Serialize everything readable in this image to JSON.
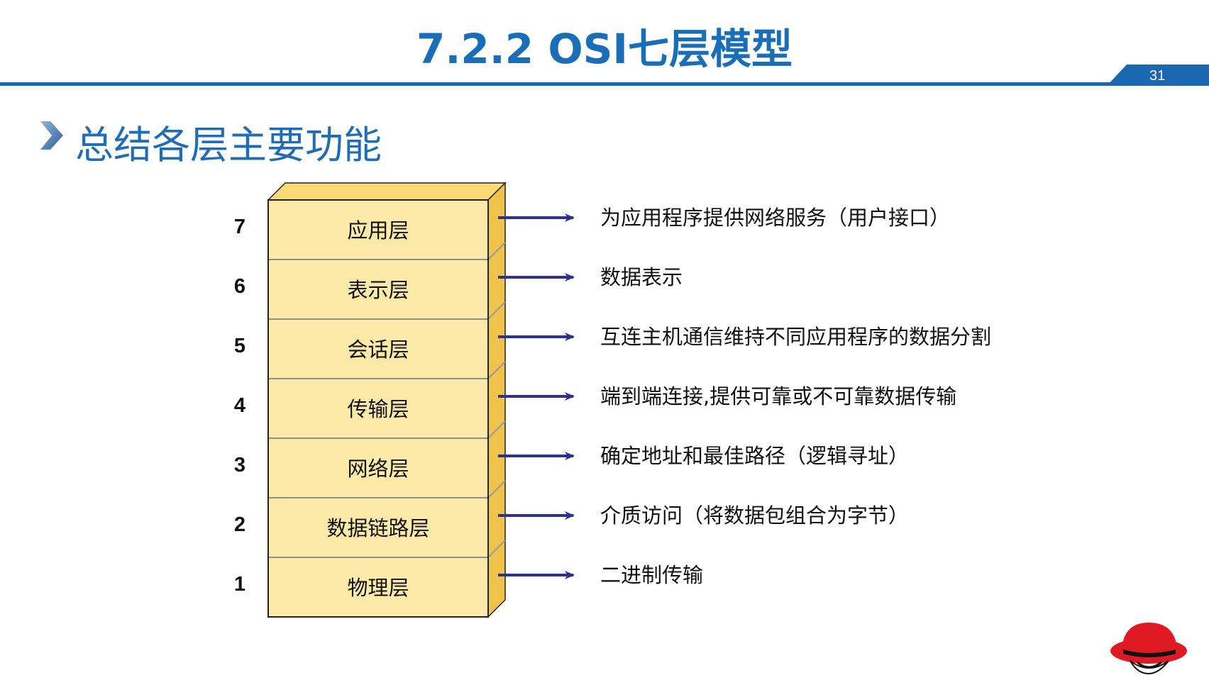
{
  "slide": {
    "title": "7.2.2 OSI七层模型",
    "page_number": "31",
    "section_heading": "总结各层主要功能"
  },
  "colors": {
    "brand_blue": "#1b67b1",
    "layer_front": "#fdeaa9",
    "layer_top": "#fbd976",
    "layer_side": "#f0c44a",
    "arrow": "#2e3192"
  },
  "icons": {
    "bullet": "chevron-right-icon",
    "logo": "red-hat-logo"
  },
  "layers": [
    {
      "number": "7",
      "name": "应用层",
      "function": "为应用程序提供网络服务（用户接口）"
    },
    {
      "number": "6",
      "name": "表示层",
      "function": "数据表示"
    },
    {
      "number": "5",
      "name": "会话层",
      "function": "互连主机通信维持不同应用程序的数据分割"
    },
    {
      "number": "4",
      "name": "传输层",
      "function": "端到端连接,提供可靠或不可靠数据传输"
    },
    {
      "number": "3",
      "name": "网络层",
      "function": "确定地址和最佳路径（逻辑寻址）"
    },
    {
      "number": "2",
      "name": "数据链路层",
      "function": "介质访问（将数据包组合为字节）"
    },
    {
      "number": "1",
      "name": "物理层",
      "function": "二进制传输"
    }
  ]
}
